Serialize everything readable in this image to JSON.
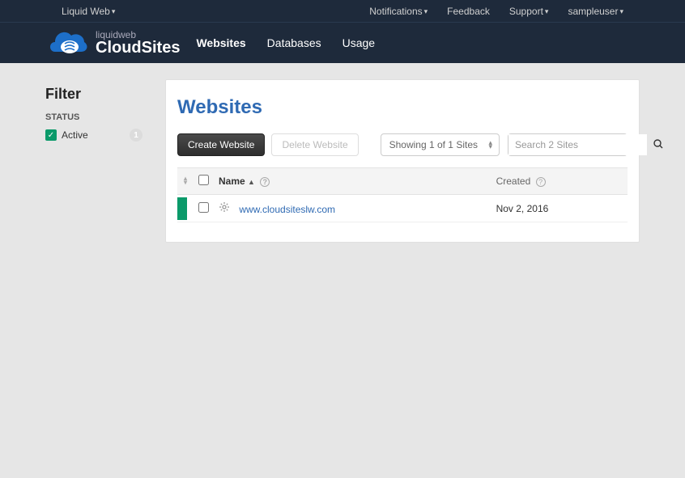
{
  "topbar": {
    "brand": "Liquid Web",
    "notifications": "Notifications",
    "feedback": "Feedback",
    "support": "Support",
    "user": "sampleuser"
  },
  "logo": {
    "line1": "liquidweb",
    "line2": "CloudSites"
  },
  "nav": {
    "websites": "Websites",
    "databases": "Databases",
    "usage": "Usage"
  },
  "sidebar": {
    "title": "Filter",
    "status_label": "STATUS",
    "active_label": "Active",
    "active_count": "1"
  },
  "main": {
    "heading": "Websites",
    "create_btn": "Create Website",
    "delete_btn": "Delete Website",
    "showing": "Showing 1 of 1 Sites",
    "search_placeholder": "Search 2 Sites",
    "columns": {
      "name": "Name",
      "created": "Created"
    },
    "rows": [
      {
        "site": "www.cloudsiteslw.com",
        "created": "Nov 2, 2016"
      }
    ]
  }
}
